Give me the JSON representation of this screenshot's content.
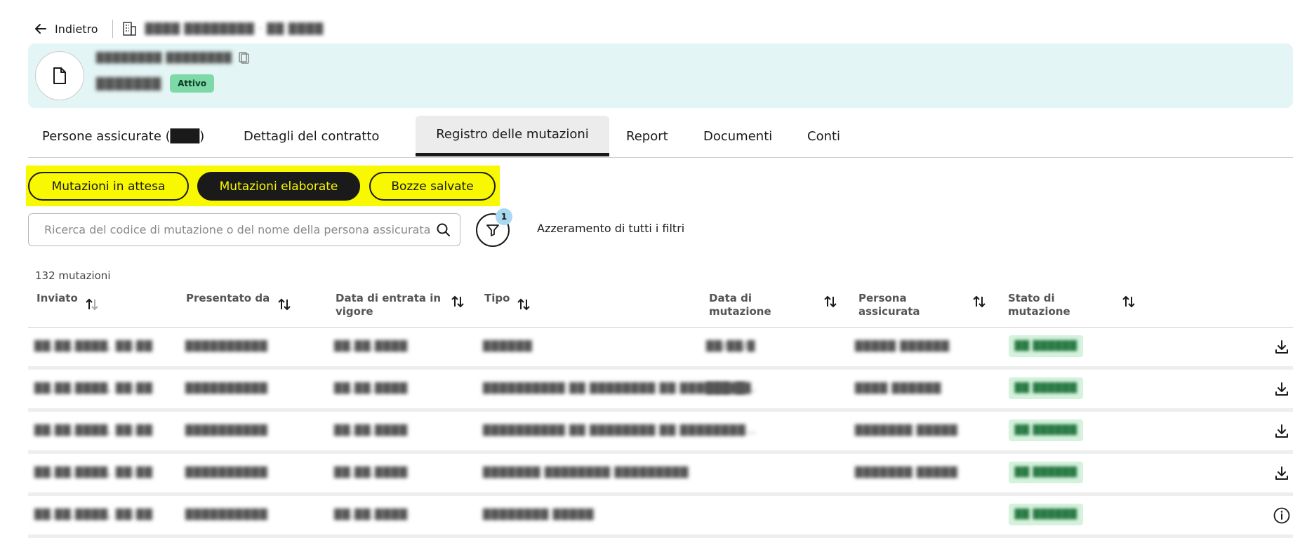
{
  "topbar": {
    "back_label": "Indietro",
    "breadcrumb_blurred": "████ ████████ · ██ ████"
  },
  "banner": {
    "contract_label_blurred": "████████ ████████",
    "contract_number_blurred": "███████",
    "status_badge": "Attivo"
  },
  "tabs": [
    {
      "label": "Persone assicurate (███)"
    },
    {
      "label": "Dettagli del contratto"
    },
    {
      "label": "Registro delle mutazioni"
    },
    {
      "label": "Report"
    },
    {
      "label": "Documenti"
    },
    {
      "label": "Conti"
    }
  ],
  "active_tab": "Registro delle mutazioni",
  "segments": [
    {
      "label": "Mutazioni in attesa"
    },
    {
      "label": "Mutazioni elaborate"
    },
    {
      "label": "Bozze salvate"
    }
  ],
  "active_segment": "Mutazioni elaborate",
  "search": {
    "placeholder": "Ricerca del codice di mutazione o del nome della persona assicurata",
    "value": ""
  },
  "filter": {
    "active_count": "1",
    "reset_label": "Azzeramento di tutti i filtri"
  },
  "result_count": "132 mutazioni",
  "table": {
    "columns": [
      {
        "label": "Inviato"
      },
      {
        "label": "Presentato da"
      },
      {
        "label": "Data di entrata in vigore"
      },
      {
        "label": "Tipo"
      },
      {
        "label": "Data di mutazione"
      },
      {
        "label": "Persona assicurata"
      },
      {
        "label": "Stato di mutazione"
      }
    ],
    "rows": [
      {
        "sent": "██.██.████, ██:██",
        "by": "██████████",
        "effective": "██.██.████",
        "type": "██████",
        "mutation_date": "██/██/█",
        "person": "█████ ██████",
        "status": "██ ██████",
        "action": "download-icon"
      },
      {
        "sent": "██.██.████, ██:██",
        "by": "██████████",
        "effective": "██.██.████",
        "type": "██████████ ██ ████████ ██ ████████…",
        "mutation_date": "███/██",
        "person": "████ ██████",
        "status": "██ ██████",
        "action": "download-icon"
      },
      {
        "sent": "██.██.████, ██:██",
        "by": "██████████",
        "effective": "██.██.████",
        "type": "██████████ ██ ████████ ██ ████████…",
        "mutation_date": "",
        "person": "███████ █████",
        "status": "██ ██████",
        "action": "download-icon"
      },
      {
        "sent": "██.██.████, ██:██",
        "by": "██████████",
        "effective": "██.██.████",
        "type": "███████ ████████ █████████",
        "mutation_date": "",
        "person": "███████ █████",
        "status": "██ ██████",
        "action": "download-icon"
      },
      {
        "sent": "██.██.████, ██:██",
        "by": "██████████",
        "effective": "██.██.████",
        "type": "████████ █████",
        "mutation_date": "",
        "person": "",
        "status": "██ ██████",
        "action": "info-icon"
      }
    ]
  },
  "colors": {
    "banner_bg": "#e3f5f4",
    "highlight_yellow": "#f8f800",
    "badge_green": "#7ed9a8",
    "status_green_bg": "#d4f2dc",
    "filter_badge": "#a9d8f2"
  }
}
